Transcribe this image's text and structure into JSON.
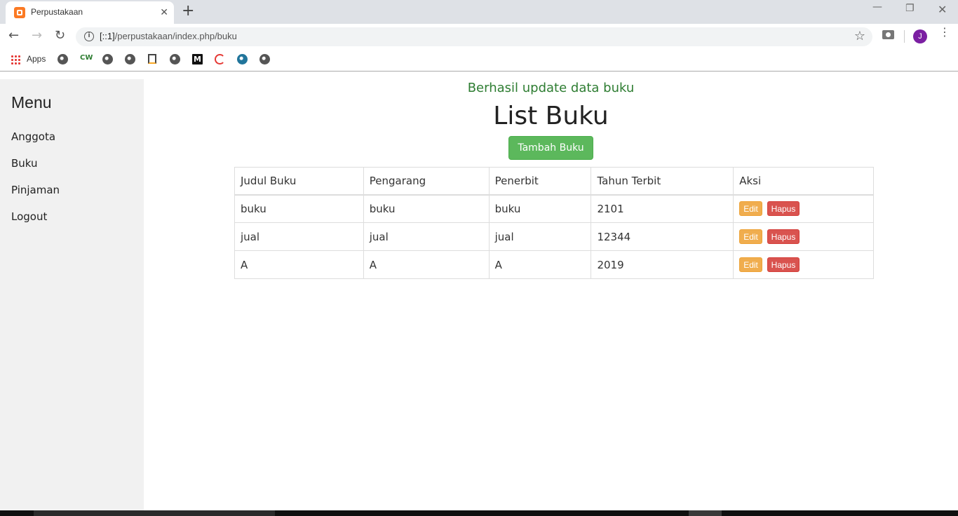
{
  "browser": {
    "tab_title": "Perpustakaan",
    "url_host": "[::1]",
    "url_path": "/perpustakaan/index.php/buku",
    "profile_initial": "J",
    "bookmarks_apps_label": "Apps",
    "bookmark_icons": [
      "globe-icon",
      "cw-icon",
      "globe-icon",
      "globe-icon",
      "doc-icon",
      "globe-icon",
      "medium-icon",
      "swirl-icon",
      "wordpress-icon",
      "globe-icon"
    ]
  },
  "sidebar": {
    "title": "Menu",
    "items": [
      {
        "label": "Anggota"
      },
      {
        "label": "Buku"
      },
      {
        "label": "Pinjaman"
      },
      {
        "label": "Logout"
      }
    ]
  },
  "main": {
    "flash_message": "Berhasil update data buku",
    "title": "List Buku",
    "add_button": "Tambah Buku",
    "table": {
      "headers": [
        "Judul Buku",
        "Pengarang",
        "Penerbit",
        "Tahun Terbit",
        "Aksi"
      ],
      "rows": [
        {
          "judul": "buku",
          "pengarang": "buku",
          "penerbit": "buku",
          "tahun": "2101"
        },
        {
          "judul": "jual",
          "pengarang": "jual",
          "penerbit": "jual",
          "tahun": "12344"
        },
        {
          "judul": "A",
          "pengarang": "A",
          "penerbit": "A",
          "tahun": "2019"
        }
      ],
      "edit_label": "Edit",
      "delete_label": "Hapus"
    }
  },
  "colors": {
    "success_text": "#2e7d32",
    "add_button": "#5cb85c",
    "edit_button": "#f0ad4e",
    "delete_button": "#d9534f",
    "sidebar_bg": "#f1f1f1"
  }
}
